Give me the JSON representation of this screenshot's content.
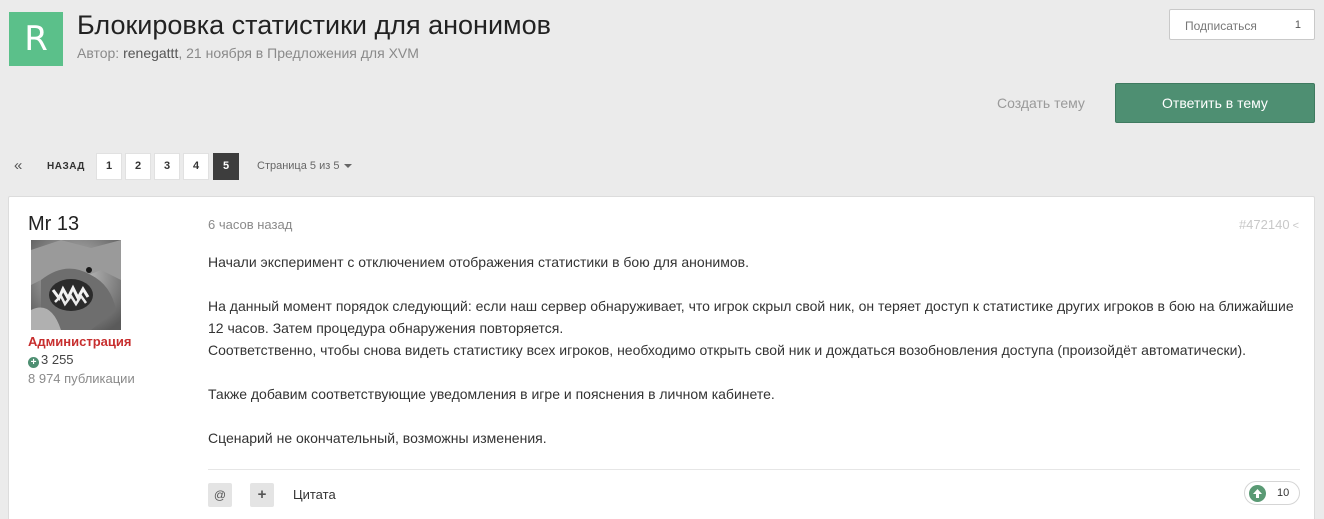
{
  "topic": {
    "icon_letter": "R",
    "title": "Блокировка статистики для анонимов",
    "author_prefix": "Автор: ",
    "author": "renegattt",
    "meta_suffix": ", 21 ноября в Предложения для XVM"
  },
  "subscribe": {
    "label": "Подписаться",
    "count": "1"
  },
  "actions": {
    "create_topic": "Создать тему",
    "reply": "Ответить в тему"
  },
  "pagination": {
    "first_icon": "double-chevron-left-icon",
    "back_label": "НАЗАД",
    "pages": [
      "1",
      "2",
      "3",
      "4",
      "5"
    ],
    "current": "5",
    "info": "Страница 5 из 5"
  },
  "post": {
    "username": "Mr 13",
    "role": "Администрация",
    "reputation": "3 255",
    "publications": "8 974 публикации",
    "time": "6 часов назад",
    "number": "#472140",
    "paragraphs": [
      "Начали эксперимент с отключением отображения статистики в бою для анонимов.",
      "На данный момент порядок следующий: если наш сервер обнаруживает, что игрок скрыл свой ник, он теряет доступ к статистике других игроков в бою на ближайшие 12 часов. Затем процедура обнаружения повторяется.",
      "Соответственно, чтобы снова видеть статистику всех игроков, необходимо открыть свой ник и дождаться возобновления доступа (произойдёт автоматически).",
      "Также добавим соответствующие уведомления в игре и пояснения в личном кабинете.",
      "Сценарий не окончательный, возможны изменения."
    ],
    "footer": {
      "mention": "@",
      "add": "+",
      "quote": "Цитата",
      "likes": "10"
    }
  },
  "colors": {
    "accent": "#4e8f72",
    "topic_icon": "#5bc08a",
    "role": "#c72e2e"
  }
}
